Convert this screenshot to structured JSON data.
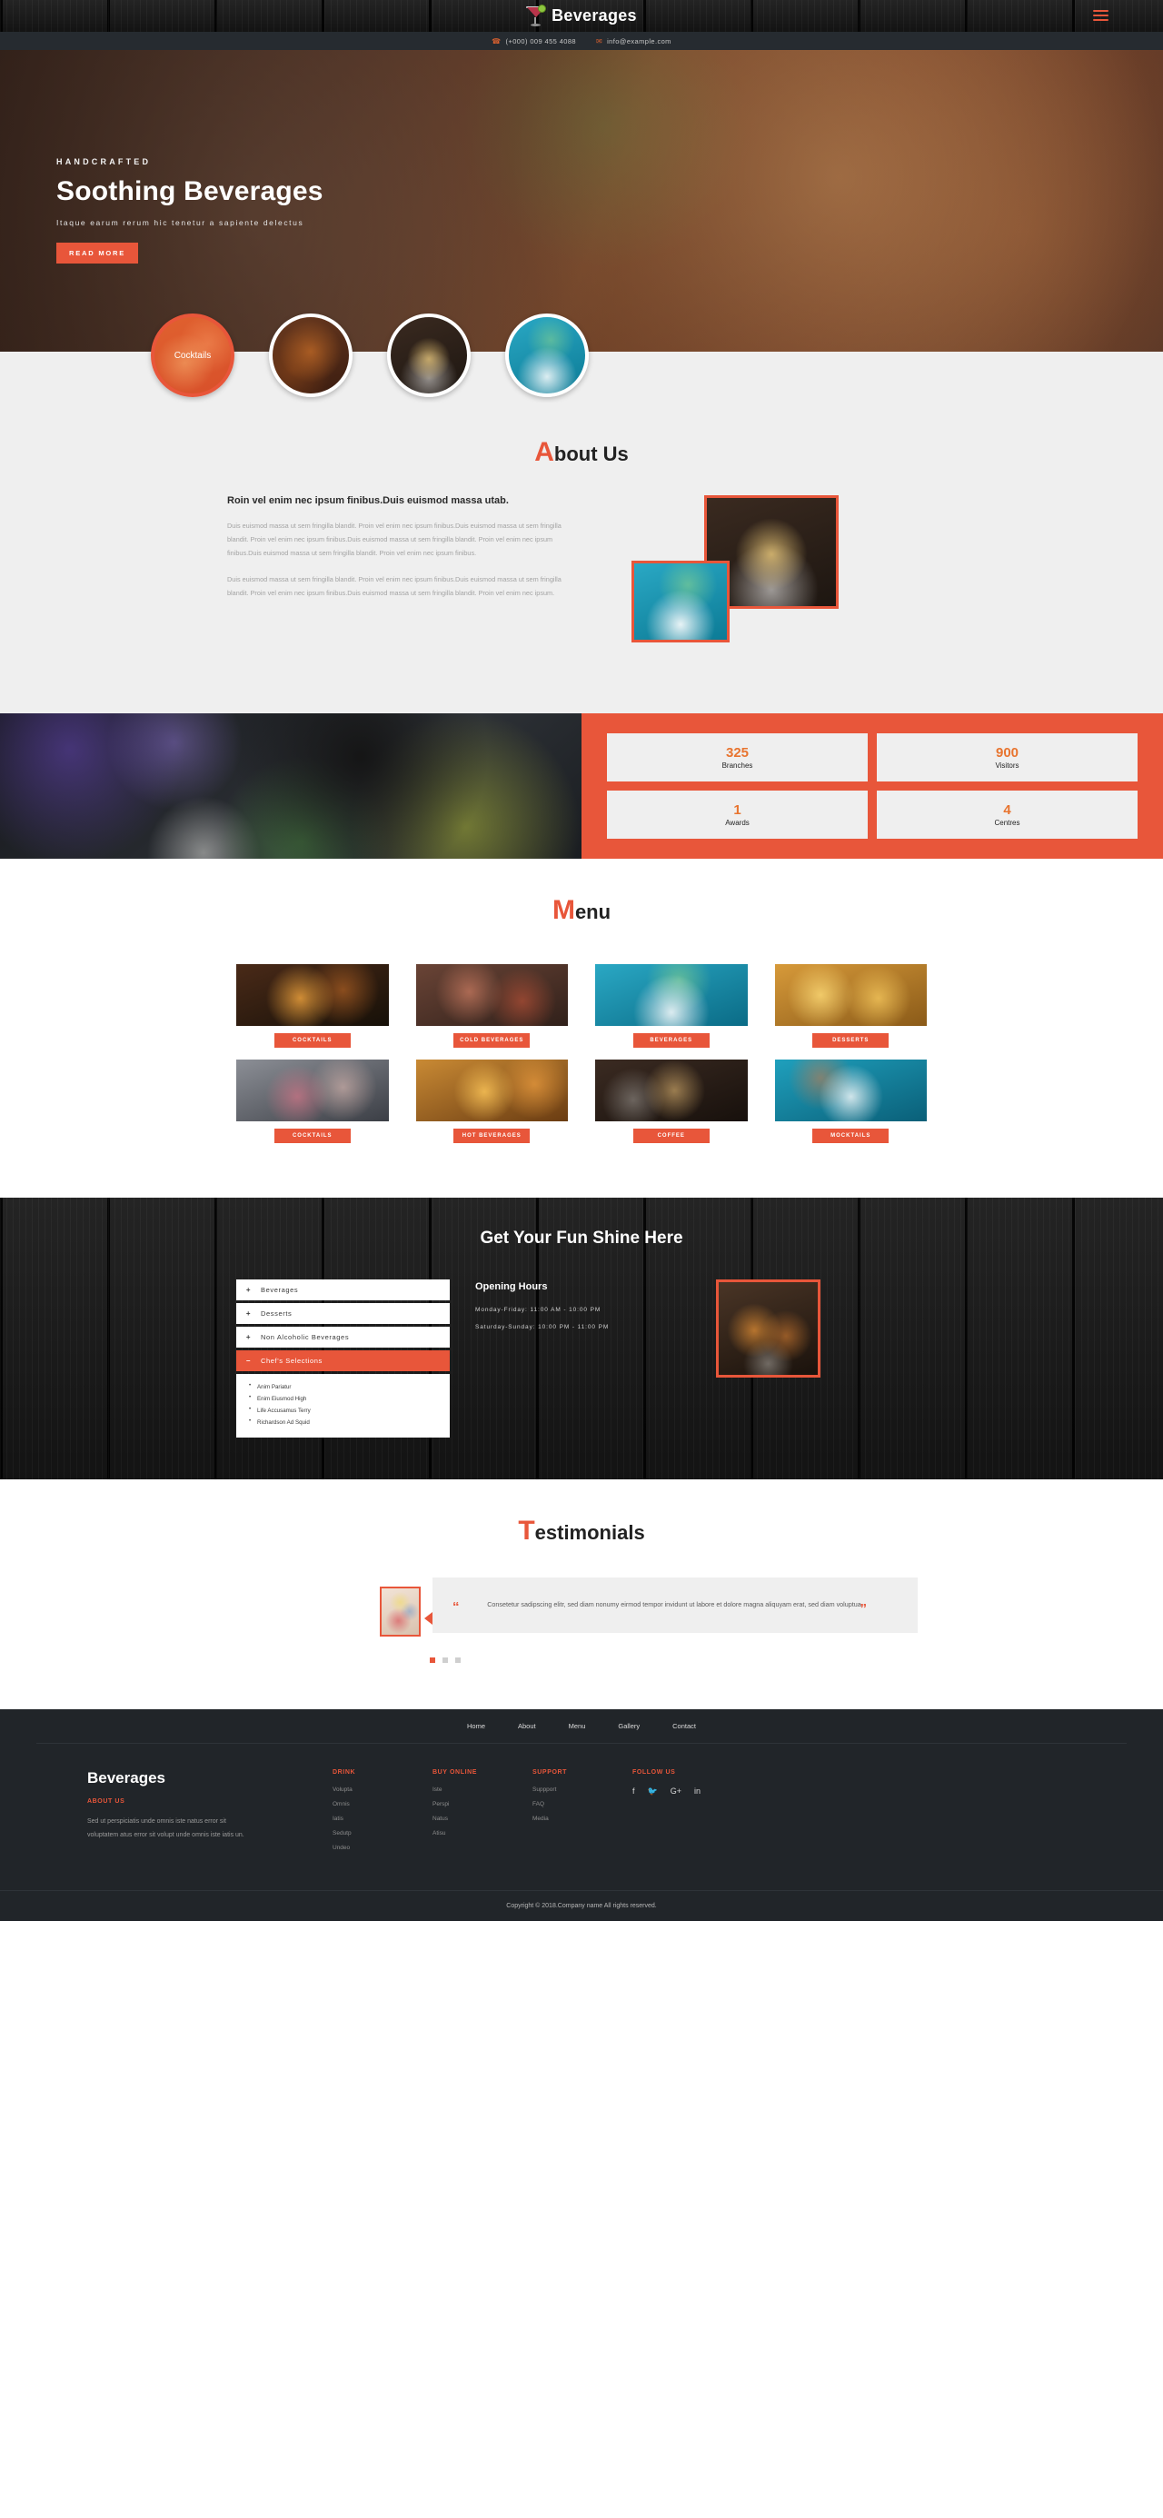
{
  "brand": {
    "name": "Beverages",
    "logo_icon": "cocktail-glass-icon",
    "menu_icon": "hamburger-menu-icon"
  },
  "contact": {
    "phone": "(+000) 009 455 4088",
    "email": "info@example.com",
    "phone_icon": "phone-icon",
    "email_icon": "envelope-icon"
  },
  "hero": {
    "kicker": "HANDCRAFTED",
    "title": "Soothing Beverages",
    "subtitle": "Itaque earum rerum hic tenetur a sapiente delectus",
    "cta": "READ MORE"
  },
  "circles": [
    {
      "label": "Cocktails",
      "name": "circle-cocktails"
    },
    {
      "label": "",
      "name": "circle-cold-drink"
    },
    {
      "label": "",
      "name": "circle-hot-drink"
    },
    {
      "label": "",
      "name": "circle-blue-mocktail"
    }
  ],
  "about": {
    "heading_cap": "A",
    "heading_rest": "bout Us",
    "lead": "Roin vel enim nec ipsum finibus.Duis euismod massa utab.",
    "p1": "Duis euismod massa ut sem fringilla blandit. Proin vel enim nec ipsum finibus.Duis euismod massa ut sem fringilla blandit. Proin vel enim nec ipsum finibus.Duis euismod massa ut sem fringilla blandit. Proin vel enim nec ipsum finibus.Duis euismod massa ut sem fringilla blandit. Proin vel enim nec ipsum finibus.",
    "p2": "Duis euismod massa ut sem fringilla blandit. Proin vel enim nec ipsum finibus.Duis euismod massa ut sem fringilla blandit. Proin vel enim nec ipsum finibus.Duis euismod massa ut sem fringilla blandit. Proin vel enim nec ipsum."
  },
  "stats": [
    {
      "number": "325",
      "label": "Branches"
    },
    {
      "number": "900",
      "label": "Visitors"
    },
    {
      "number": "1",
      "label": "Awards"
    },
    {
      "number": "4",
      "label": "Centres"
    }
  ],
  "menu": {
    "heading_cap": "M",
    "heading_rest": "enu",
    "items": [
      {
        "label": "COCKTAILS"
      },
      {
        "label": "COLD BEVERAGES"
      },
      {
        "label": "BEVERAGES"
      },
      {
        "label": "DESSERTS"
      },
      {
        "label": "COCKTAILS"
      },
      {
        "label": "HOT BEVERAGES"
      },
      {
        "label": "COFFEE"
      },
      {
        "label": "MOCKTAILS"
      }
    ]
  },
  "fun": {
    "title": "Get Your Fun Shine Here",
    "accordion": [
      {
        "label": "Beverages",
        "sign": "+",
        "open": false
      },
      {
        "label": "Desserts",
        "sign": "+",
        "open": false
      },
      {
        "label": "Non Alcoholic Beverages",
        "sign": "+",
        "open": false
      },
      {
        "label": "Chef's Selections",
        "sign": "–",
        "open": true
      }
    ],
    "panel_items": [
      "Anim Pariatur",
      "Enim Eiusmod High",
      "Life Accusamus Terry",
      "Richardson Ad Squid"
    ],
    "hours_title": "Opening Hours",
    "hours_weekday": "Monday-Friday: 11:00 AM - 10:00 PM",
    "hours_weekend": "Saturday-Sunday: 10:00 PM - 11:00 PM"
  },
  "testimonials": {
    "heading_cap": "T",
    "heading_rest": "estimonials",
    "quote_open": "“",
    "quote_close": "”",
    "text": "Consetetur sadipscing elitr, sed diam nonumy eirmod tempor invidunt ut labore et dolore magna aliquyam erat, sed diam voluptua.",
    "dots": 3,
    "active_dot": 0
  },
  "footer": {
    "nav": [
      "Home",
      "About",
      "Menu",
      "Gallery",
      "Contact"
    ],
    "brand": "Beverages",
    "about_title": "ABOUT US",
    "about_text": "Sed ut perspiciatis unde omnis iste natus error sit voluptatem atus error sit volupt unde omnis iste iatis un.",
    "columns": [
      {
        "title": "DRINK",
        "items": [
          "Volupta",
          "Omnis",
          "Iatis",
          "Sedutp",
          "Undeo"
        ]
      },
      {
        "title": "BUY ONLINE",
        "items": [
          "Iste",
          "Perspi",
          "Natus",
          "Atisu"
        ]
      },
      {
        "title": "SUPPORT",
        "items": [
          "Suppport",
          "FAQ",
          "Media"
        ]
      }
    ],
    "follow_title": "FOLLOW US",
    "social": [
      {
        "glyph": "f",
        "name": "facebook-icon"
      },
      {
        "glyph": "ᵛ",
        "name": "twitter-icon"
      },
      {
        "glyph": "G+",
        "name": "google-plus-icon"
      },
      {
        "glyph": "in",
        "name": "linkedin-icon"
      }
    ],
    "copyright": "Copyright © 2018.Company name All rights reserved."
  },
  "colors": {
    "accent": "#e8563a",
    "dark": "#212529",
    "light": "#efefef",
    "stat_number": "#e8742f"
  }
}
